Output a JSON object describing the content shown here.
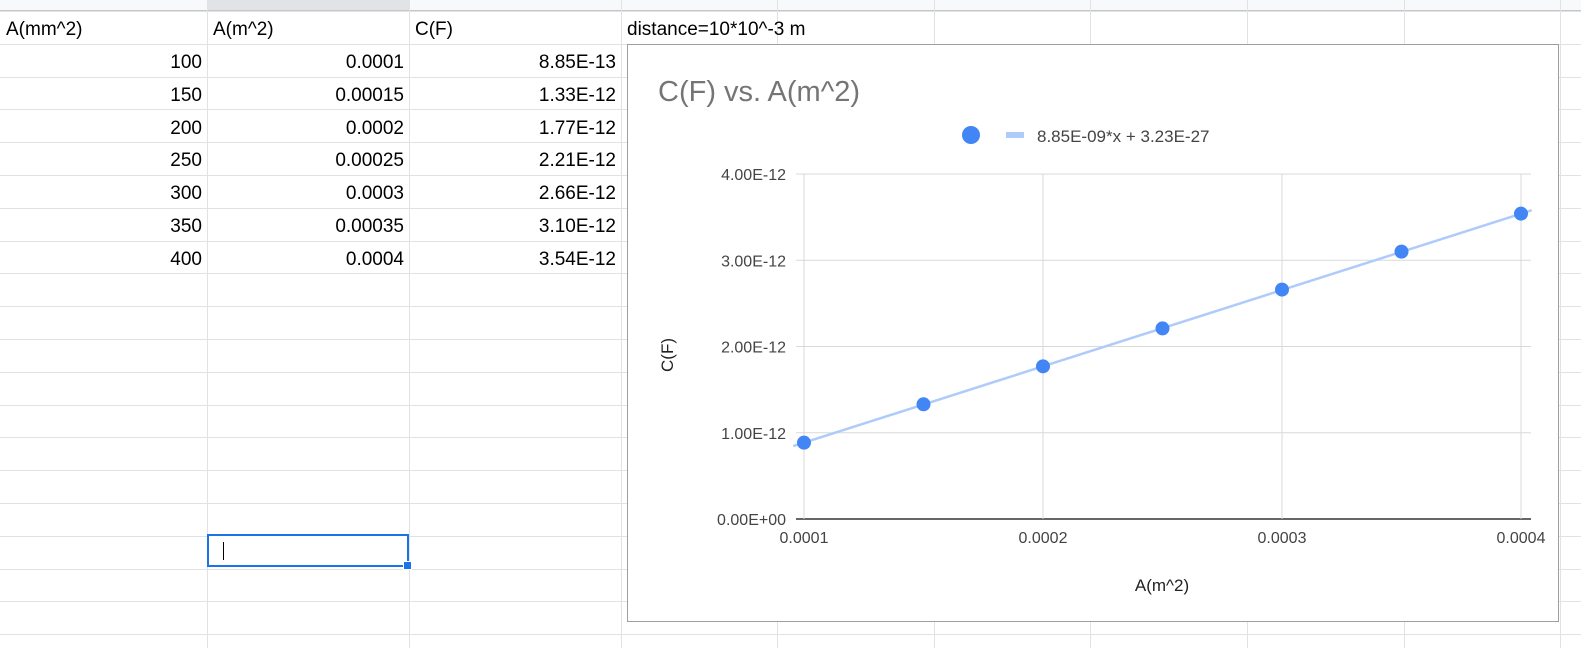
{
  "sheet": {
    "headers": {
      "col_a": "A(mm^2)",
      "col_b": "A(m^2)",
      "col_c": "C(F)",
      "col_d": "distance=10*10^-3 m"
    },
    "rows": [
      {
        "a": "100",
        "b": "0.0001",
        "c": "8.85E-13"
      },
      {
        "a": "150",
        "b": "0.00015",
        "c": "1.33E-12"
      },
      {
        "a": "200",
        "b": "0.0002",
        "c": "1.77E-12"
      },
      {
        "a": "250",
        "b": "0.00025",
        "c": "2.21E-12"
      },
      {
        "a": "300",
        "b": "0.0003",
        "c": "2.66E-12"
      },
      {
        "a": "350",
        "b": "0.00035",
        "c": "3.10E-12"
      },
      {
        "a": "400",
        "b": "0.0004",
        "c": "3.54E-12"
      }
    ],
    "active_cell_value": ""
  },
  "chart_data": {
    "type": "scatter",
    "title": "C(F) vs. A(m^2)",
    "xlabel": "A(m^2)",
    "ylabel": "C(F)",
    "x": [
      0.0001,
      0.00015,
      0.0002,
      0.00025,
      0.0003,
      0.00035,
      0.0004
    ],
    "series": [
      {
        "values": [
          8.85e-13,
          1.33e-12,
          1.77e-12,
          2.21e-12,
          2.66e-12,
          3.1e-12,
          3.54e-12
        ],
        "color": "#4285f4"
      }
    ],
    "trendline": {
      "label": "8.85E-09*x + 3.23E-27",
      "slope": 8.85e-09,
      "intercept": 3.23e-27,
      "color": "#aecbfa"
    },
    "xlim": [
      0.0001,
      0.0004
    ],
    "ylim": [
      0,
      4e-12
    ],
    "x_ticks": [
      "0.0001",
      "0.0002",
      "0.0003",
      "0.0004"
    ],
    "y_ticks": [
      "0.00E+00",
      "1.00E-12",
      "2.00E-12",
      "3.00E-12",
      "4.00E-12"
    ],
    "grid": true,
    "legend_position": "top"
  }
}
